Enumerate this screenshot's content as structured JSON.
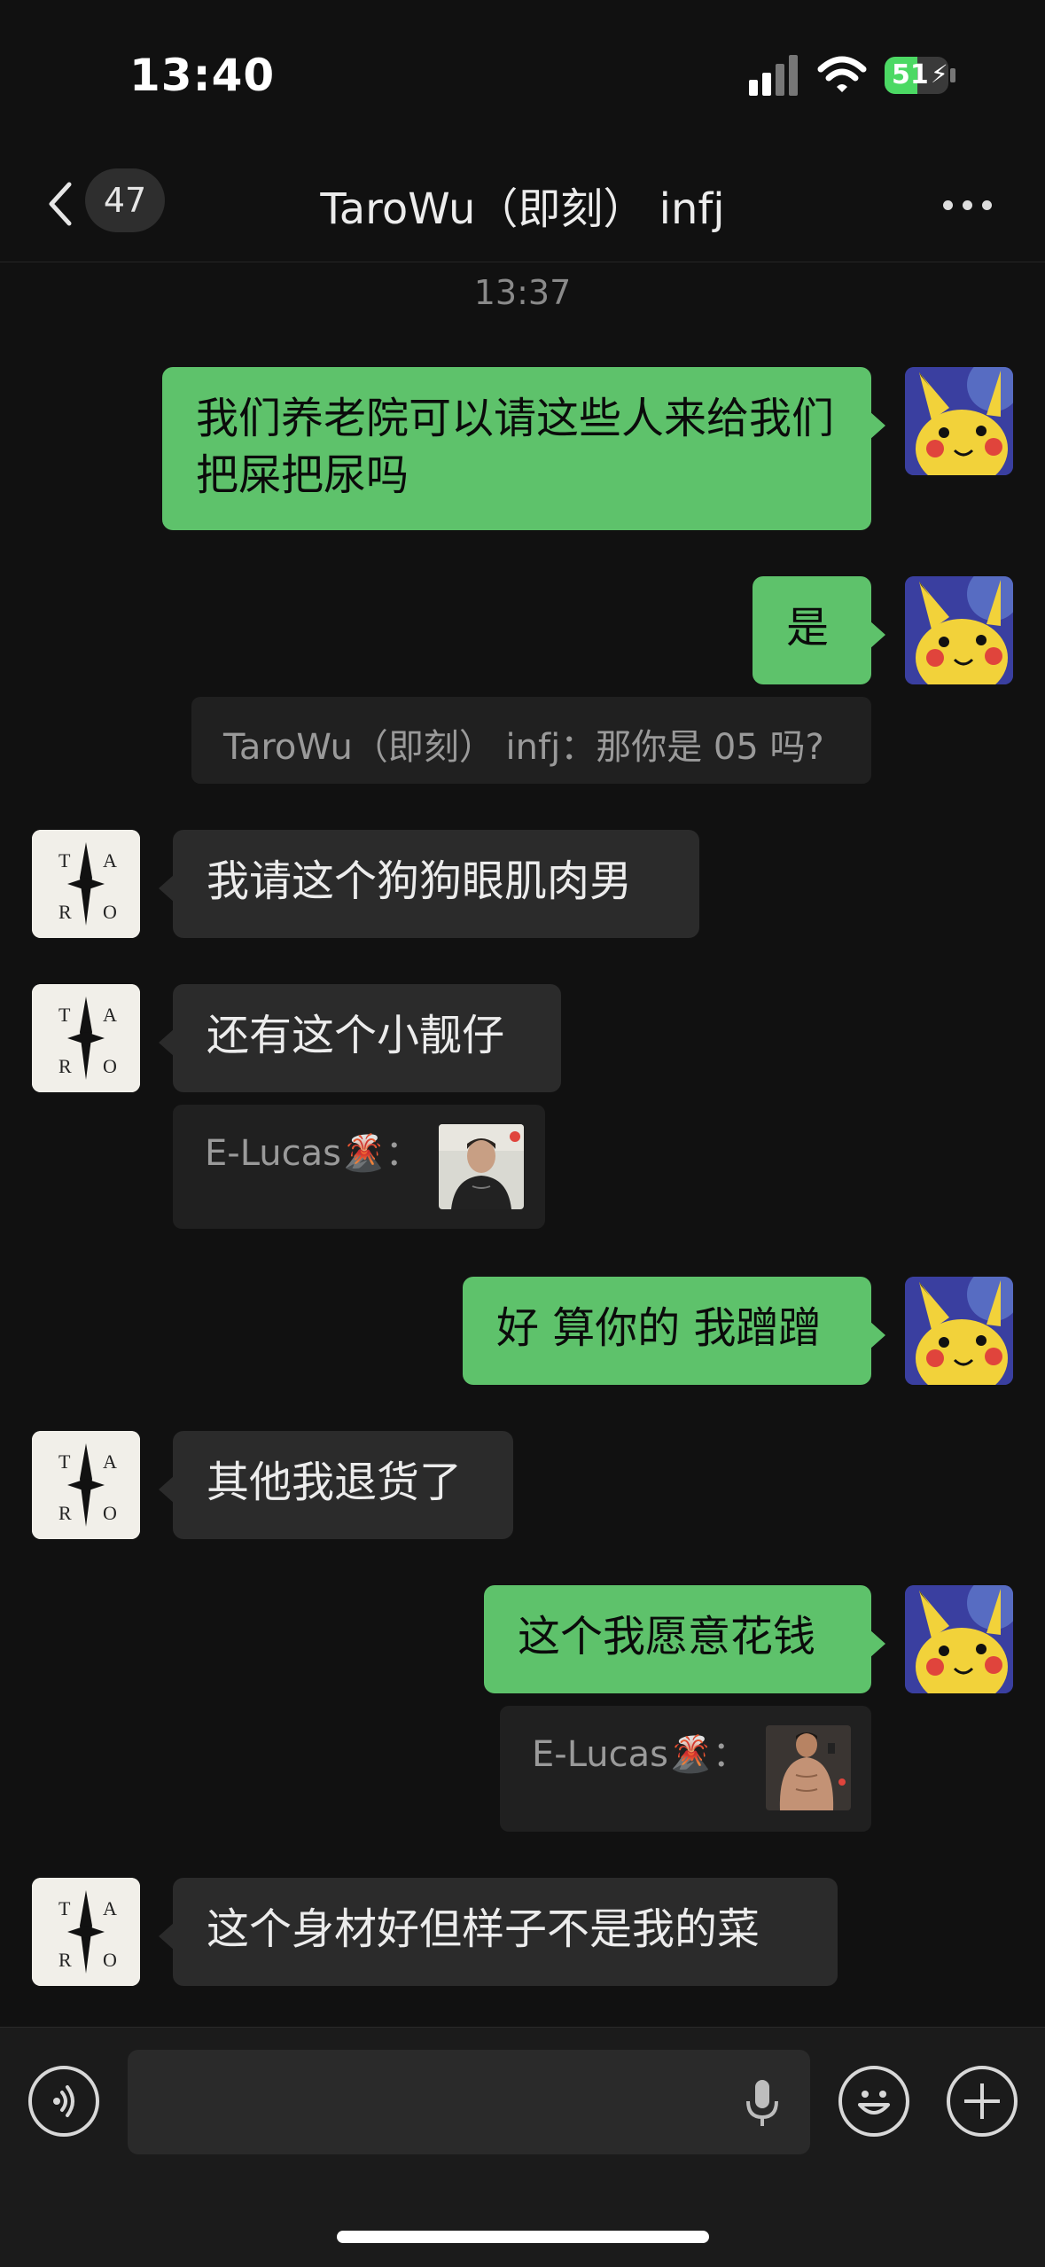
{
  "status_bar": {
    "time": "13:40",
    "battery": "51"
  },
  "header": {
    "unread_count": "47",
    "title": "TaroWu（即刻） infj"
  },
  "messages": {
    "timestamp": "13:37",
    "m1": "我们养老院可以请这些人来给我们把屎把尿吗",
    "m2": "是",
    "m2_quote": "TaroWu（即刻） infj：那你是 05 吗?",
    "m3": "我请这个狗狗眼肌肉男",
    "m4": "还有这个小靓仔",
    "m4_quote": "E-Lucas🌋：",
    "m5": "好 算你的 我蹭蹭",
    "m6": "其他我退货了",
    "m7": "这个我愿意花钱",
    "m7_quote": "E-Lucas🌋：",
    "m8": "这个身材好但样子不是我的菜"
  },
  "icons": {
    "back": "chevron-left-icon",
    "more": "ellipsis-icon",
    "voice": "voice-toggle-icon",
    "mic": "microphone-icon",
    "emoji": "emoji-icon",
    "add": "plus-icon"
  },
  "colors": {
    "background": "#111111",
    "outgoing_bubble": "#5ec26b",
    "incoming_bubble": "#2b2b2b",
    "battery_green": "#4cd964"
  }
}
